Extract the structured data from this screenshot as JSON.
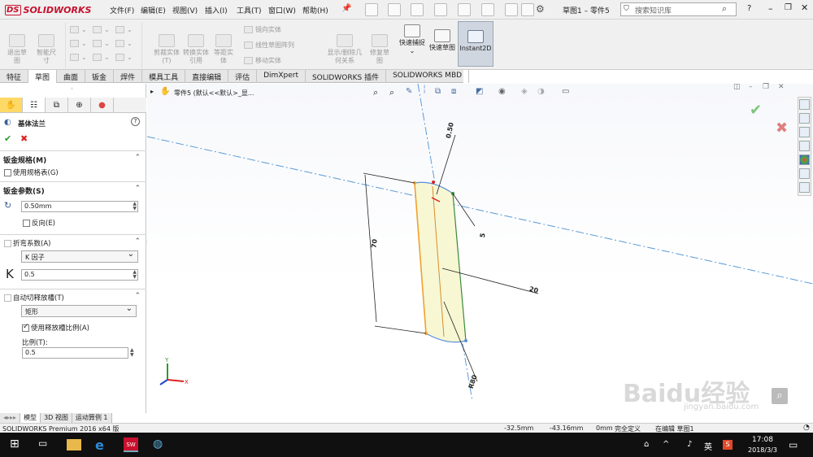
{
  "app": {
    "logo_text": "SOLIDWORKS",
    "title": "草图1 – 零件5",
    "menu": [
      "文件(F)",
      "编辑(E)",
      "视图(V)",
      "插入(I)",
      "工具(T)",
      "窗口(W)",
      "帮助(H)"
    ],
    "search_placeholder": "搜索知识库",
    "brand_color": "#c8102e"
  },
  "ribbon": {
    "exit_sketch": "退出草图",
    "smart_dim": "智能尺寸",
    "trim": "剪裁实体(T)",
    "convert": "转换实体引用",
    "offset": "等距实体",
    "mirror": "镜向实体",
    "linear_pattern": "线性草图阵列",
    "move": "移动实体",
    "show_relations": "显示/删除几何关系",
    "repair": "修复草图",
    "quick_snap": "快速捕捉",
    "rapid_sketch": "快速草图",
    "instant2d": "Instant2D"
  },
  "command_tabs": [
    "特征",
    "草图",
    "曲面",
    "钣金",
    "焊件",
    "模具工具",
    "直接编辑",
    "评估",
    "DimXpert",
    "SOLIDWORKS 插件",
    "SOLIDWORKS MBD"
  ],
  "feature_tree": {
    "part_label": "零件5  (默认<<默认>_显..."
  },
  "property_manager": {
    "title": "基体法兰",
    "sheet_metal_gauges": {
      "header": "钣金规格(M)",
      "use_gauge_table": "使用规格表(G)"
    },
    "sheet_metal_params": {
      "header": "钣金参数(S)",
      "thickness": "0.50mm",
      "reverse": "反向(E)"
    },
    "bend_allowance": {
      "header": "折弯系数(A)",
      "type": "K 因子",
      "k_label": "K",
      "k_value": "0.5"
    },
    "auto_relief": {
      "header": "自动切释放槽(T)",
      "type": "矩形",
      "use_ratio": "使用释放槽比例(A)",
      "ratio_label": "比例(T):",
      "ratio_value": "0.5"
    }
  },
  "sketch": {
    "dim_top": "0.50",
    "dim_right_small": "5",
    "dim_left": "70",
    "dim_mid": "20",
    "dim_bottom": "R80",
    "accent_orange": "#f0a030",
    "sketch_blue": "#5b8fd8"
  },
  "bottom_tabs": [
    "模型",
    "3D 视图",
    "运动算例 1"
  ],
  "status": {
    "app_version": "SOLIDWORKS Premium 2016 x64 版",
    "x": "-32.5mm",
    "y": "-43.16mm",
    "z": "0mm",
    "state": "完全定义",
    "editing": "在编辑 草图1"
  },
  "taskbar": {
    "ime": "英",
    "time": "17:08",
    "date": "2018/3/3"
  },
  "watermark": {
    "brand": "Baidu经验",
    "url": "jingyan.baidu.com"
  }
}
